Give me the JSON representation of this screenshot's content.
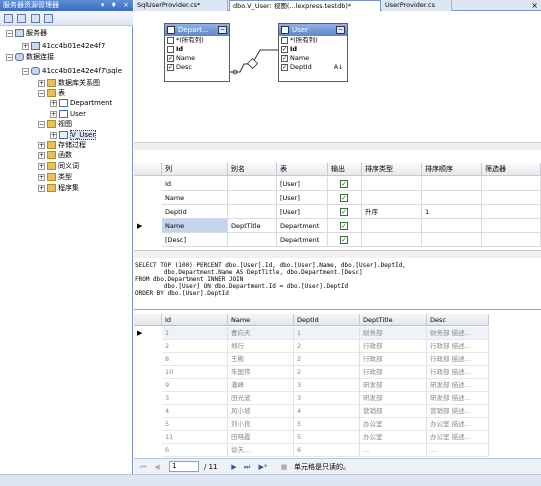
{
  "explorer": {
    "title": "服务器资源管理器",
    "title_buttons": "▾ ♦ ×",
    "tree": [
      {
        "label": "服务器",
        "level": 0,
        "icon": "server-icon",
        "expander": "−"
      },
      {
        "label": "41cc4b01e42e4f7",
        "level": 1,
        "icon": "server-icon",
        "expander": "+"
      },
      {
        "label": "数据连接",
        "level": 0,
        "icon": "database-icon",
        "expander": "−"
      },
      {
        "label": "41cc4b01e42e4f7\\sqle",
        "level": 1,
        "icon": "database-icon",
        "expander": "−"
      },
      {
        "label": "数据库关系图",
        "level": 2,
        "icon": "folder-icon",
        "expander": "+"
      },
      {
        "label": "表",
        "level": 2,
        "icon": "folder-icon",
        "expander": "−"
      },
      {
        "label": "Department",
        "level": 3,
        "icon": "table-icon",
        "expander": "+"
      },
      {
        "label": "User",
        "level": 3,
        "icon": "table-icon",
        "expander": "+"
      },
      {
        "label": "视图",
        "level": 2,
        "icon": "folder-icon",
        "expander": "−"
      },
      {
        "label": "V_User",
        "level": 3,
        "icon": "view-icon",
        "expander": "+"
      },
      {
        "label": "存储过程",
        "level": 2,
        "icon": "folder-icon",
        "expander": "+"
      },
      {
        "label": "函数",
        "level": 2,
        "icon": "folder-icon",
        "expander": "+"
      },
      {
        "label": "同义词",
        "level": 2,
        "icon": "folder-icon",
        "expander": "+"
      },
      {
        "label": "类型",
        "level": 2,
        "icon": "folder-icon",
        "expander": "+"
      },
      {
        "label": "程序集",
        "level": 2,
        "icon": "folder-icon",
        "expander": "+"
      }
    ]
  },
  "tabs": [
    {
      "label": "SqlUserProvider.cs*",
      "active": false
    },
    {
      "label": "dbo.V_User: 视图(...lexpress.testdb)*",
      "active": true
    },
    {
      "label": "UserProvider.cs",
      "active": false
    }
  ],
  "tab_close": "×",
  "diagram": {
    "tables": [
      {
        "title": "Depart...",
        "columns": [
          {
            "name": "*(所有列)",
            "checked": false,
            "bold": false
          },
          {
            "name": "Id",
            "checked": false,
            "bold": true
          },
          {
            "name": "Name",
            "checked": true,
            "bold": false
          },
          {
            "name": "Desc",
            "checked": true,
            "bold": false
          }
        ]
      },
      {
        "title": "User",
        "columns": [
          {
            "name": "*(所有列)",
            "checked": false,
            "bold": false
          },
          {
            "name": "Id",
            "checked": true,
            "bold": true
          },
          {
            "name": "Name",
            "checked": true,
            "bold": false
          },
          {
            "name": "DeptId",
            "checked": true,
            "bold": false,
            "sort_glyph": "A↓"
          }
        ]
      }
    ]
  },
  "criteria_grid": {
    "headers": [
      "列",
      "别名",
      "表",
      "输出",
      "排序类型",
      "排序顺序",
      "筛选器"
    ],
    "rows": [
      {
        "column": "Id",
        "alias": "",
        "table": "[User]",
        "output": true,
        "sort_type": "",
        "sort_order": "",
        "filter": "",
        "current": false
      },
      {
        "column": "Name",
        "alias": "",
        "table": "[User]",
        "output": true,
        "sort_type": "",
        "sort_order": "",
        "filter": "",
        "current": false
      },
      {
        "column": "DeptId",
        "alias": "",
        "table": "[User]",
        "output": true,
        "sort_type": "升序",
        "sort_order": "1",
        "filter": "",
        "current": false
      },
      {
        "column": "Name",
        "alias": "DeptTitle",
        "table": "Department",
        "output": true,
        "sort_type": "",
        "sort_order": "",
        "filter": "",
        "current": true
      },
      {
        "column": "[Desc]",
        "alias": "",
        "table": "Department",
        "output": true,
        "sort_type": "",
        "sort_order": "",
        "filter": "",
        "current": false
      }
    ]
  },
  "sql_lines": [
    "SELECT TOP (100) PERCENT dbo.[User].Id, dbo.[User].Name, dbo.[User].DeptId,",
    "        dbo.Department.Name AS DeptTitle, dbo.Department.[Desc]",
    "FROM dbo.Department INNER JOIN",
    "        dbo.[User] ON dbo.Department.Id = dbo.[User].DeptId",
    "ORDER BY dbo.[User].DeptId"
  ],
  "results": {
    "headers": [
      "Id",
      "Name",
      "DeptId",
      "DeptTitle",
      "Desc"
    ],
    "rows": [
      [
        "1",
        "曹向天",
        "1",
        "财务部",
        "财务部 描述..."
      ],
      [
        "2",
        "郑行",
        "2",
        "行政部",
        "行政部 描述..."
      ],
      [
        "8",
        "王殿",
        "2",
        "行政部",
        "行政部 描述..."
      ],
      [
        "10",
        "朱国伟",
        "2",
        "行政部",
        "行政部 描述..."
      ],
      [
        "9",
        "潘峰",
        "3",
        "研发部",
        "研发部 描述..."
      ],
      [
        "3",
        "田光波",
        "3",
        "研发部",
        "研发部 描述..."
      ],
      [
        "4",
        "风小坡",
        "4",
        "营销部",
        "营销部 描述..."
      ],
      [
        "5",
        "刘小良",
        "5",
        "办公室",
        "办公室 描述..."
      ],
      [
        "11",
        "田晓霞",
        "5",
        "办公室",
        "办公室 描述..."
      ],
      [
        "6",
        "徐天...",
        "6",
        "...",
        "..."
      ]
    ]
  },
  "navigation": {
    "first": "⏮",
    "prev": "◀",
    "current_page": "1",
    "page_total": "/ 11",
    "next": "▶",
    "last": "⏭",
    "new": "▶*",
    "stop": "■",
    "status": "单元格是只读的。"
  }
}
